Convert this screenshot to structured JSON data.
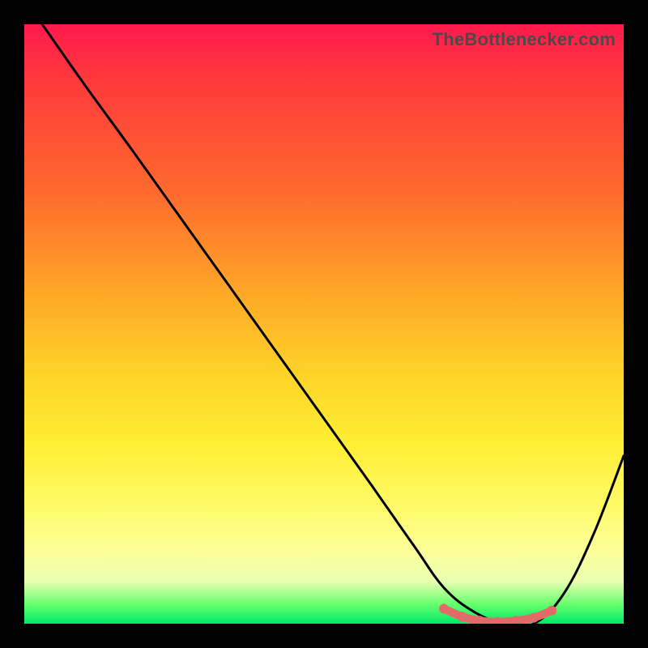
{
  "watermark": "TheBottlenecker.com",
  "chart_data": {
    "type": "line",
    "title": "",
    "xlabel": "",
    "ylabel": "",
    "xlim": [
      0,
      100
    ],
    "ylim": [
      0,
      100
    ],
    "grid": false,
    "series": [
      {
        "name": "curve",
        "color": "#000000",
        "x": [
          3,
          10,
          18,
          28,
          38,
          48,
          58,
          65,
          70,
          75,
          80,
          85,
          90,
          95,
          100
        ],
        "y": [
          100,
          90,
          79,
          65,
          51,
          37,
          23,
          13,
          6,
          2,
          0,
          0,
          5,
          15,
          28
        ]
      }
    ],
    "highlight_segment": {
      "name": "optimal-range",
      "color": "#e46a6a",
      "x": [
        70,
        73,
        76,
        79,
        82,
        85,
        88
      ],
      "y": [
        2.5,
        1.2,
        0.5,
        0.3,
        0.5,
        1.0,
        2.2
      ]
    }
  }
}
